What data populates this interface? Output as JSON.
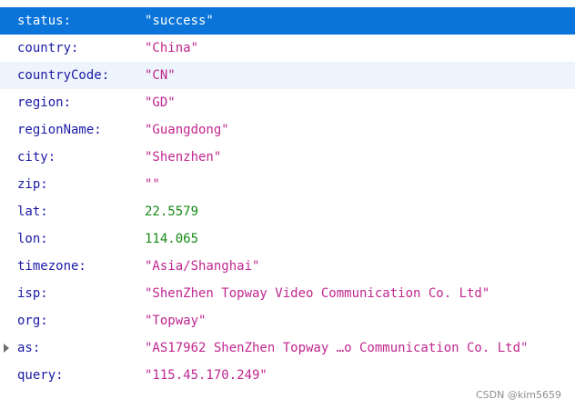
{
  "rows": [
    {
      "key": "status:",
      "value": "\"success\"",
      "type": "string"
    },
    {
      "key": "country:",
      "value": "\"China\"",
      "type": "string"
    },
    {
      "key": "countryCode:",
      "value": "\"CN\"",
      "type": "string"
    },
    {
      "key": "region:",
      "value": "\"GD\"",
      "type": "string"
    },
    {
      "key": "regionName:",
      "value": "\"Guangdong\"",
      "type": "string"
    },
    {
      "key": "city:",
      "value": "\"Shenzhen\"",
      "type": "string"
    },
    {
      "key": "zip:",
      "value": "\"\"",
      "type": "string"
    },
    {
      "key": "lat:",
      "value": "22.5579",
      "type": "number"
    },
    {
      "key": "lon:",
      "value": "114.065",
      "type": "number"
    },
    {
      "key": "timezone:",
      "value": "\"Asia/Shanghai\"",
      "type": "string"
    },
    {
      "key": "isp:",
      "value": "\"ShenZhen Topway Video Communication Co. Ltd\"",
      "type": "string"
    },
    {
      "key": "org:",
      "value": "\"Topway\"",
      "type": "string"
    },
    {
      "key": "as:",
      "value": "\"AS17962 ShenZhen Topway …o Communication Co. Ltd\"",
      "type": "string"
    },
    {
      "key": "query:",
      "value": "\"115.45.170.249\"",
      "type": "string"
    }
  ],
  "colors": {
    "selected_row_bg": "#0a74da",
    "hover_row_bg": "#eef4fb",
    "key_text": "#1a1aa6",
    "string_value": "#c0278f",
    "number_value": "#158a15"
  },
  "watermark": "CSDN @kim5659"
}
